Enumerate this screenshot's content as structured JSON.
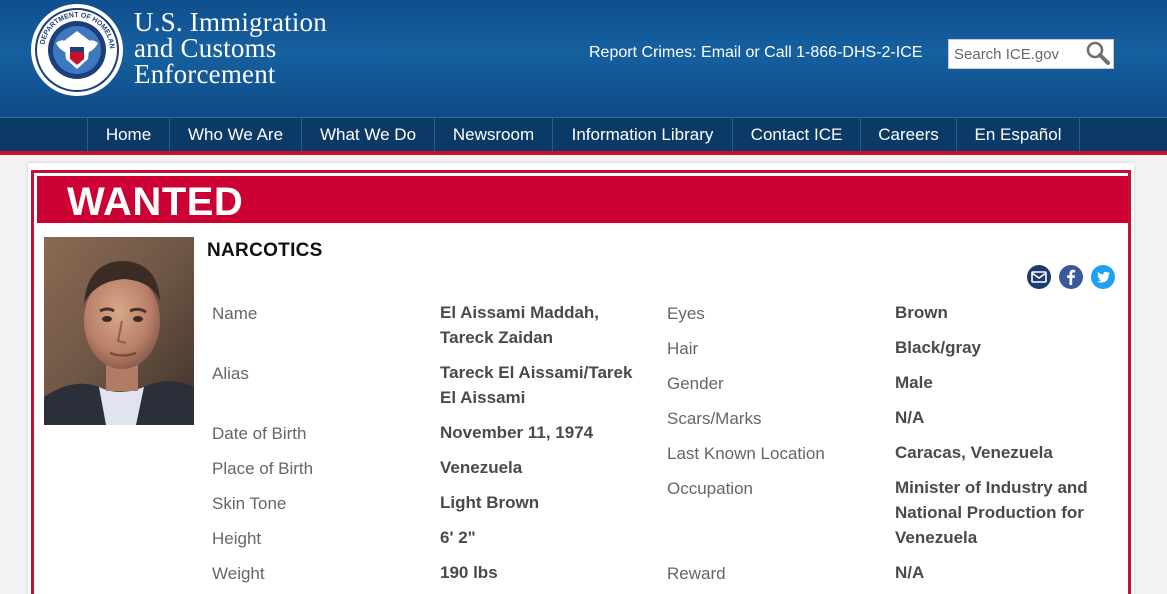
{
  "header": {
    "seal_text": "DEPARTMENT OF HOMELAND SECURITY",
    "agency_line1": "U.S. Immigration",
    "agency_line2": "and Customs",
    "agency_line3": "Enforcement",
    "report_crimes": "Report Crimes: Email or Call 1-866-DHS-2-ICE",
    "search": {
      "placeholder": "Search ICE.gov",
      "icon": "magnifier-icon"
    }
  },
  "nav": {
    "items": [
      {
        "label": "Home"
      },
      {
        "label": "Who We Are"
      },
      {
        "label": "What We Do"
      },
      {
        "label": "Newsroom"
      },
      {
        "label": "Information Library"
      },
      {
        "label": "Contact ICE"
      },
      {
        "label": "Careers"
      },
      {
        "label": "En Español"
      }
    ]
  },
  "wanted": {
    "title": "WANTED",
    "category": "NARCOTICS",
    "share_icons": [
      "email-icon",
      "facebook-icon",
      "twitter-icon"
    ],
    "left": [
      {
        "label": "Name",
        "value_line1": "El Aissami Maddah,",
        "value_line2": "Tareck Zaidan"
      },
      {
        "label": "Alias",
        "value_line1": "Tareck El Aissami/Tarek",
        "value_line2": "El Aissami"
      },
      {
        "label": "Date of Birth",
        "value_line1": "November 11, 1974"
      },
      {
        "label": "Place of Birth",
        "value_line1": "Venezuela"
      },
      {
        "label": "Skin Tone",
        "value_line1": "Light Brown"
      },
      {
        "label": "Height",
        "value_line1": "6' 2\""
      },
      {
        "label": "Weight",
        "value_line1": "190 lbs"
      }
    ],
    "right": [
      {
        "label": "Eyes",
        "value_line1": "Brown"
      },
      {
        "label": "Hair",
        "value_line1": "Black/gray"
      },
      {
        "label": "Gender",
        "value_line1": "Male"
      },
      {
        "label": "Scars/Marks",
        "value_line1": "N/A"
      },
      {
        "label": "Last Known Location",
        "value_line1": "Caracas, Venezuela"
      },
      {
        "label": "Occupation",
        "value_line1": "Minister of Industry and",
        "value_line2": "National Production for",
        "value_line3": "Venezuela"
      },
      {
        "label": "Reward",
        "value_line1": "N/A"
      }
    ]
  },
  "colors": {
    "header_blue": "#16609f",
    "nav_blue": "#0b3a66",
    "wanted_red": "#cc0033"
  }
}
